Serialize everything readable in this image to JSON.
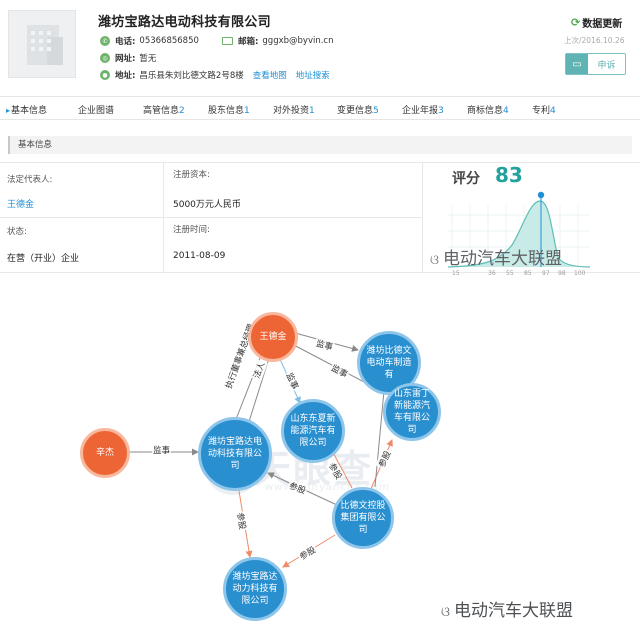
{
  "company": {
    "name": "潍坊宝路达电动科技有限公司",
    "phone_label": "电话:",
    "phone": "05366856850",
    "email_label": "邮箱:",
    "email": "gggxb@byvin.cn",
    "website_label": "网址:",
    "website": "暂无",
    "address_label": "地址:",
    "address": "昌乐县朱刘比德文路2号8楼",
    "view_map": "查看地图",
    "search_address": "地址搜索"
  },
  "actions": {
    "update_label": "数据更新",
    "last_update": "上次/2016.10.26",
    "complain_label": "申诉"
  },
  "tabs": [
    {
      "label": "基本信息",
      "count": ""
    },
    {
      "label": "企业图谱",
      "count": ""
    },
    {
      "label": "高管信息",
      "count": "2"
    },
    {
      "label": "股东信息",
      "count": "1"
    },
    {
      "label": "对外投资",
      "count": "1"
    },
    {
      "label": "变更信息",
      "count": "5"
    },
    {
      "label": "企业年报",
      "count": "3"
    },
    {
      "label": "商标信息",
      "count": "4"
    },
    {
      "label": "专利",
      "count": "4"
    }
  ],
  "basic_info": {
    "section_title": "基本信息",
    "legal_rep_label": "法定代表人:",
    "legal_rep": "王德金",
    "capital_label": "注册资本:",
    "capital": "5000万元人民币",
    "status_label": "状态:",
    "status": "在营（开业）企业",
    "reg_time_label": "注册时间:",
    "reg_time": "2011-08-09",
    "score_label": "评分",
    "score": "83",
    "score_ticks": [
      "15",
      "36",
      "55",
      "85",
      "97",
      "98",
      "100"
    ]
  },
  "watermark": {
    "text": "电动汽车大联盟",
    "graph_brand": "天眼查",
    "graph_url": "www.tianyancha.com"
  },
  "graph": {
    "nodes": [
      {
        "id": "wang",
        "label": "王德金",
        "type": "person"
      },
      {
        "id": "xinjie",
        "label": "辛杰",
        "type": "person"
      },
      {
        "id": "baoluda",
        "label": "潍坊宝路达电动科技有限公司",
        "type": "company"
      },
      {
        "id": "bidewen_mfg",
        "label": "潍坊比德文电动车制造有",
        "type": "company"
      },
      {
        "id": "dongxia",
        "label": "山东东夏新能源汽车有限公司",
        "type": "company"
      },
      {
        "id": "leiding",
        "label": "山东雷丁新能源汽车有限公司",
        "type": "company"
      },
      {
        "id": "bidewen_group",
        "label": "比德文控股集团有限公司",
        "type": "company"
      },
      {
        "id": "dongli",
        "label": "潍坊宝路达动力科技有限公司",
        "type": "company"
      }
    ],
    "edges": [
      {
        "from": "wang",
        "to": "baoluda",
        "label": "执行董事兼总经理"
      },
      {
        "from": "wang",
        "to": "baoluda",
        "label": "法人"
      },
      {
        "from": "wang",
        "to": "bidewen_mfg",
        "label": "监事"
      },
      {
        "from": "wang",
        "to": "dongxia",
        "label": "监事"
      },
      {
        "from": "wang",
        "to": "leiding",
        "label": "监事"
      },
      {
        "from": "xinjie",
        "to": "baoluda",
        "label": "监事"
      },
      {
        "from": "bidewen_group",
        "to": "baoluda",
        "label": "参股"
      },
      {
        "from": "bidewen_group",
        "to": "dongxia",
        "label": "参股"
      },
      {
        "from": "bidewen_group",
        "to": "leiding",
        "label": "参股"
      },
      {
        "from": "bidewen_group",
        "to": "dongli",
        "label": "参股"
      },
      {
        "from": "baoluda",
        "to": "dongli",
        "label": "参股"
      }
    ]
  },
  "colors": {
    "link": "#1f8fd6",
    "accent": "#22a29e",
    "company_node": "#2a8fcf",
    "person_node": "#ee6535"
  }
}
